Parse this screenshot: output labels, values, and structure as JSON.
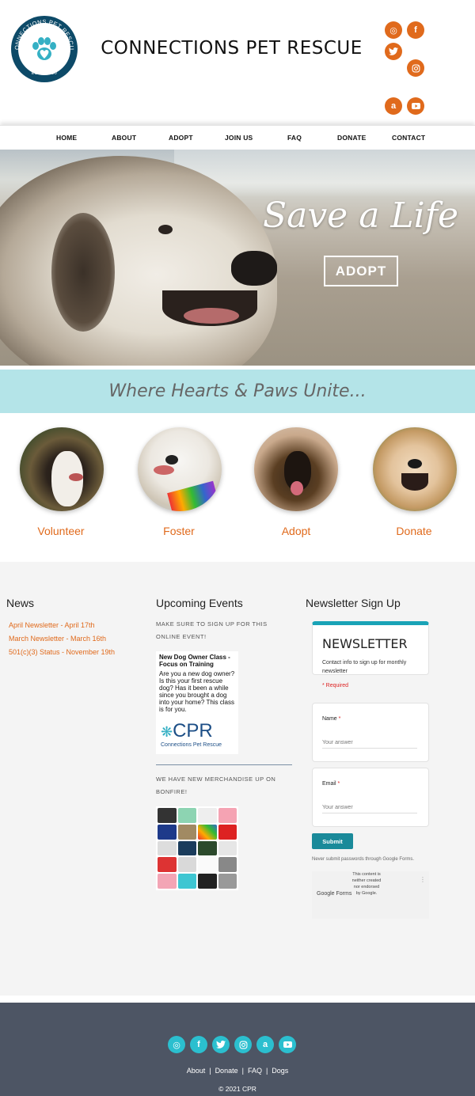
{
  "header": {
    "logo_text": "CONNECTIONS PET RESCUE",
    "logo_est": "ESTD. 2020",
    "title": "CONNECTIONS PET RESCUE",
    "social": [
      "bonfire-icon",
      "facebook-icon",
      "twitter-icon",
      "instagram-icon",
      "amazon-icon",
      "youtube-icon"
    ],
    "social_color": "#e06a1c"
  },
  "nav": {
    "items": [
      "HOME",
      "ABOUT",
      "ADOPT",
      "JOIN US",
      "FAQ",
      "DONATE",
      "CONTACT"
    ]
  },
  "hero": {
    "headline": "Save a Life",
    "button": "ADOPT"
  },
  "tagline": "Where Hearts & Paws Unite...",
  "features": [
    "Volunteer",
    "Foster",
    "Adopt",
    "Donate"
  ],
  "accent": "#e06a1c",
  "news": {
    "title": "News",
    "links": [
      "April Newsletter - April 17th",
      "March Newsletter - March 16th",
      "501(c)(3) Status - November 19th"
    ]
  },
  "events": {
    "title": "Upcoming Events",
    "note1": "MAKE SURE TO SIGN UP FOR THIS ONLINE EVENT!",
    "card_title": "New Dog Owner Class - Focus on Training",
    "card_body": "Are you a new dog owner? Is this your first rescue dog? Has it been a while since you brought a dog into your home? This class is for you.",
    "card_logo": "CPR",
    "card_logo_sub": "Connections Pet Rescue",
    "note2": "WE HAVE NEW MERCHANDISE UP ON BONFIRE!"
  },
  "newsletter": {
    "title": "Newsletter Sign Up",
    "form_heading": "NEWSLETTER",
    "form_desc": "Contact info to sign up for monthly newsletter",
    "required": "* Required",
    "fields": [
      {
        "label": "Name",
        "placeholder": "Your answer"
      },
      {
        "label": "Email",
        "placeholder": "Your answer"
      }
    ],
    "submit": "Submit",
    "never": "Never submit passwords through Google Forms.",
    "gforms_logo": "Google Forms",
    "disclaimer": "This content is neither created nor endorsed by Google.",
    "accent": "#1aa3b7"
  },
  "footer": {
    "social": [
      "bonfire-icon",
      "facebook-icon",
      "twitter-icon",
      "instagram-icon",
      "amazon-icon",
      "youtube-icon"
    ],
    "links": [
      "About",
      "Donate",
      "FAQ",
      "Dogs"
    ],
    "copyright": "© 2021 CPR",
    "icon_color": "#2bbfcf"
  }
}
